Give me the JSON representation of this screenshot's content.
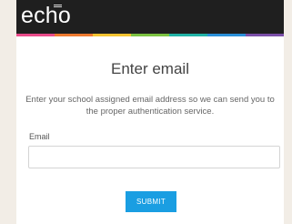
{
  "header": {
    "logo_text": "echo",
    "logo_icon": "echo-superscript-mark-icon",
    "stripe_colors": [
      "#e94b8a",
      "#ee7a30",
      "#f4c331",
      "#7cc242",
      "#22b2a6",
      "#2a8fd8",
      "#7b4fa8"
    ]
  },
  "form": {
    "title": "Enter email",
    "description": "Enter your school assigned email address so we can send you to the proper authentication service.",
    "email_label": "Email",
    "email_value": "",
    "email_placeholder": "",
    "submit_label": "SUBMIT"
  },
  "colors": {
    "header_bg": "#1f1f1f",
    "page_bg": "#f2ede6",
    "button_bg": "#1a9ee2"
  }
}
